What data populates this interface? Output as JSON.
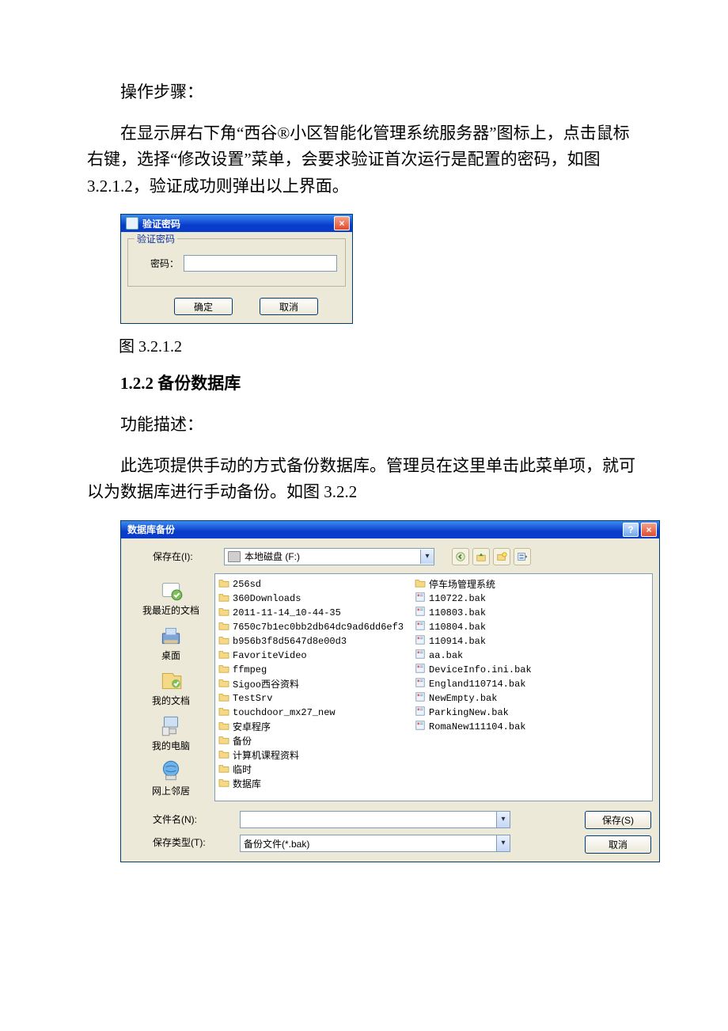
{
  "paragraphs": {
    "p1": "操作步骤：",
    "p2": "在显示屏右下角“西谷®小区智能化管理系统服务器”图标上，点击鼠标右键，选择“修改设置”菜单，会要求验证首次运行是配置的密码，如图 3.2.1.2，验证成功则弹出以上界面。",
    "caption1": "图 3.2.1.2",
    "h1": "1.2.2 备份数据库",
    "p3": "功能描述：",
    "p4": "此选项提供手动的方式备份数据库。管理员在这里单击此菜单项，就可以为数据库进行手动备份。如图 3.2.2"
  },
  "dialog1": {
    "title": "验证密码",
    "group": "验证密码",
    "label": "密码：",
    "value": "",
    "ok": "确定",
    "cancel": "取消",
    "close": "×"
  },
  "dialog2": {
    "title": "数据库备份",
    "help": "?",
    "close": "×",
    "saveInLabel": "保存在(I):",
    "saveInValue": "本地磁盘 (F:)",
    "toolbars": {
      "back": "back-icon",
      "up": "up-icon",
      "new": "new-folder-icon",
      "views": "views-icon"
    },
    "places": [
      {
        "label": "我最近的文档"
      },
      {
        "label": "桌面"
      },
      {
        "label": "我的文档"
      },
      {
        "label": "我的电脑"
      },
      {
        "label": "网上邻居"
      }
    ],
    "col1": [
      {
        "t": "folder",
        "n": "256sd"
      },
      {
        "t": "folder",
        "n": "360Downloads"
      },
      {
        "t": "folder",
        "n": "2011-11-14_10-44-35"
      },
      {
        "t": "folder",
        "n": "7650c7b1ec0bb2db64dc9ad6dd6ef3"
      },
      {
        "t": "folder",
        "n": "b956b3f8d5647d8e00d3"
      },
      {
        "t": "folder",
        "n": "FavoriteVideo"
      },
      {
        "t": "folder",
        "n": "ffmpeg"
      },
      {
        "t": "folder",
        "n": "Sigoo西谷资料"
      },
      {
        "t": "folder",
        "n": "TestSrv"
      },
      {
        "t": "folder",
        "n": "touchdoor_mx27_new"
      },
      {
        "t": "folder",
        "n": "安卓程序"
      },
      {
        "t": "folder",
        "n": "备份"
      },
      {
        "t": "folder",
        "n": "计算机课程资料"
      },
      {
        "t": "folder",
        "n": "临时"
      },
      {
        "t": "folder",
        "n": "数据库"
      }
    ],
    "col2": [
      {
        "t": "folder",
        "n": "停车场管理系统"
      },
      {
        "t": "bak",
        "n": "110722.bak"
      },
      {
        "t": "bak",
        "n": "110803.bak"
      },
      {
        "t": "bak",
        "n": "110804.bak"
      },
      {
        "t": "bak",
        "n": "110914.bak"
      },
      {
        "t": "bak",
        "n": "aa.bak"
      },
      {
        "t": "bak",
        "n": "DeviceInfo.ini.bak"
      },
      {
        "t": "bak",
        "n": "England110714.bak"
      },
      {
        "t": "bak",
        "n": "NewEmpty.bak"
      },
      {
        "t": "bak",
        "n": "ParkingNew.bak"
      },
      {
        "t": "bak",
        "n": "RomaNew111104.bak"
      }
    ],
    "fileNameLabel": "文件名(N):",
    "fileNameValue": "",
    "fileTypeLabel": "保存类型(T):",
    "fileTypeValue": "备份文件(*.bak)",
    "saveBtn": "保存(S)",
    "cancelBtn": "取消"
  }
}
